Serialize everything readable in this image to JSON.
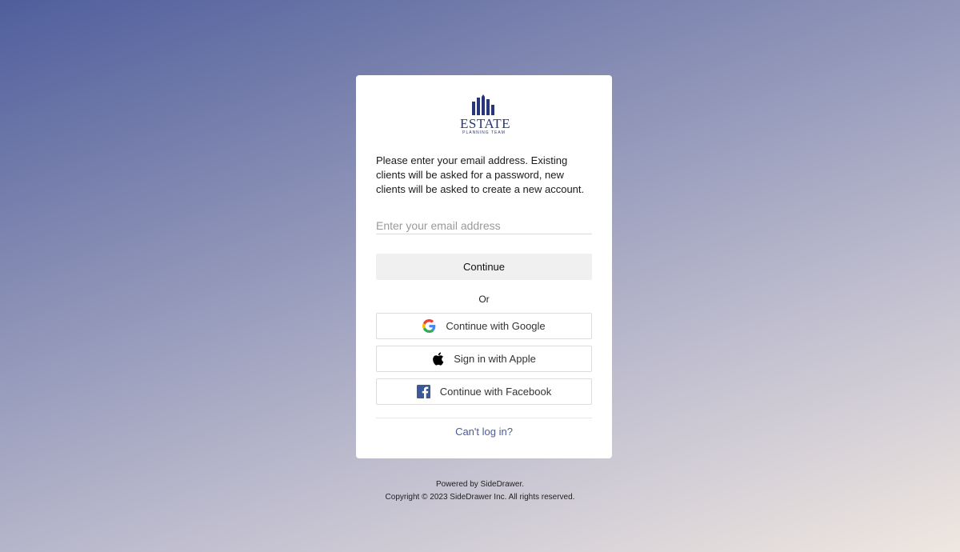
{
  "logo": {
    "word": "ESTATE",
    "sub": "PLANNING TEAM",
    "color": "#27367a"
  },
  "intro": "Please enter your email address. Existing clients will be asked for a password, new clients will be asked to create a new account.",
  "email": {
    "placeholder": "Enter your email address",
    "value": ""
  },
  "continue_label": "Continue",
  "or_label": "Or",
  "social": {
    "google": {
      "label": "Continue with Google",
      "icon": "google-icon"
    },
    "apple": {
      "label": "Sign in with Apple",
      "icon": "apple-icon"
    },
    "facebook": {
      "label": "Continue with Facebook",
      "icon": "facebook-icon"
    }
  },
  "cant_login": "Can't log in?",
  "footer": {
    "powered": "Powered by SideDrawer.",
    "copyright": "Copyright © 2023 SideDrawer Inc. All rights reserved."
  },
  "colors": {
    "link": "#4b5aa0",
    "facebook": "#3b5998"
  }
}
